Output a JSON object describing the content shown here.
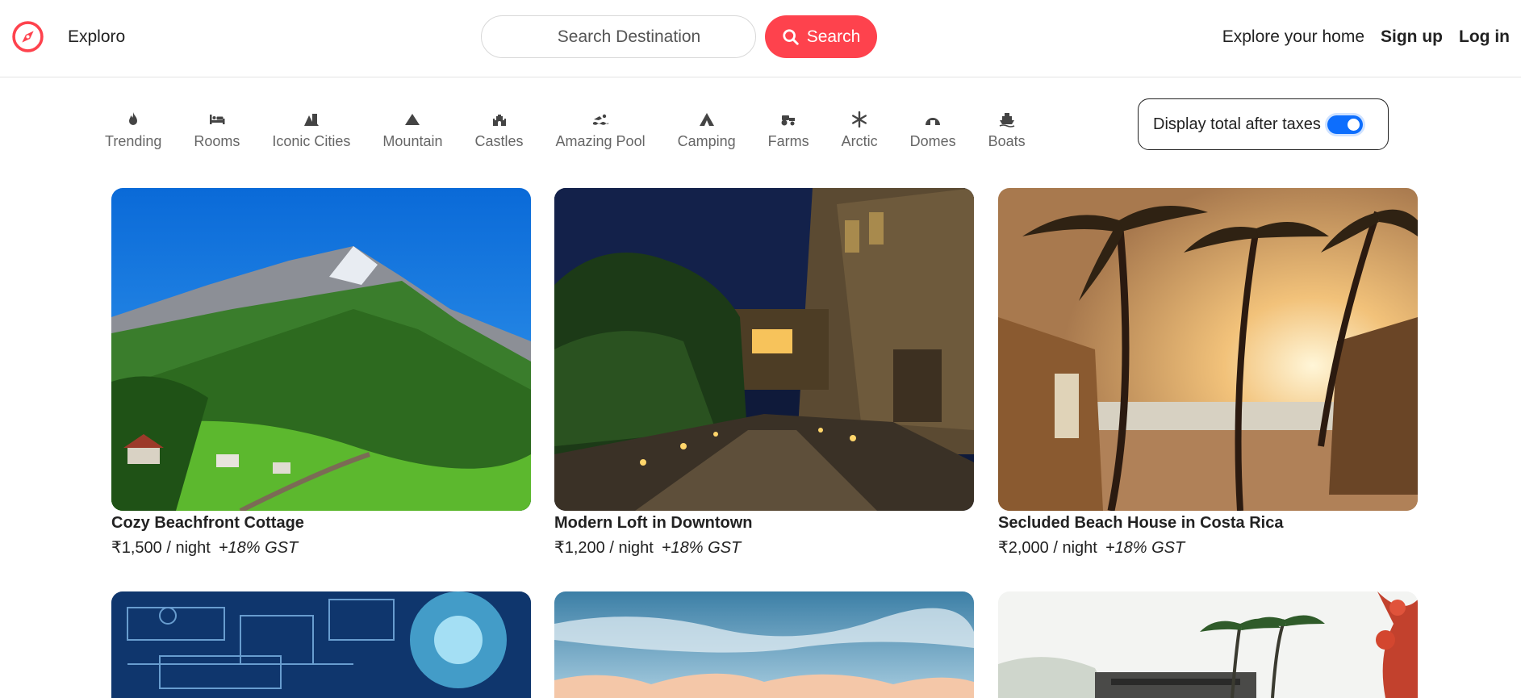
{
  "header": {
    "brand": "Exploro",
    "search_placeholder": "Search Destination",
    "search_button": "Search",
    "links": [
      "Explore your home",
      "Sign up",
      "Log in"
    ]
  },
  "filters": [
    {
      "label": "Trending",
      "icon": "fire-icon"
    },
    {
      "label": "Rooms",
      "icon": "bed-icon"
    },
    {
      "label": "Iconic Cities",
      "icon": "city-icon"
    },
    {
      "label": "Mountain",
      "icon": "mountain-icon"
    },
    {
      "label": "Castles",
      "icon": "castle-icon"
    },
    {
      "label": "Amazing Pool",
      "icon": "swimmer-icon"
    },
    {
      "label": "Camping",
      "icon": "tent-icon"
    },
    {
      "label": "Farms",
      "icon": "tractor-icon"
    },
    {
      "label": "Arctic",
      "icon": "snowflake-icon"
    },
    {
      "label": "Domes",
      "icon": "igloo-icon"
    },
    {
      "label": "Boats",
      "icon": "ship-icon"
    }
  ],
  "tax_toggle": {
    "label": "Display total after taxes",
    "checked": true
  },
  "listings": [
    {
      "title": "Cozy Beachfront Cottage",
      "price": "₹1,500 / night",
      "gst": "+18% GST"
    },
    {
      "title": "Modern Loft in Downtown",
      "price": "₹1,200 / night",
      "gst": "+18% GST"
    },
    {
      "title": "Secluded Beach House in Costa Rica",
      "price": "₹2,000 / night",
      "gst": "+18% GST"
    }
  ],
  "colors": {
    "brand": "#fe424d",
    "toggle": "#0d6efd"
  }
}
